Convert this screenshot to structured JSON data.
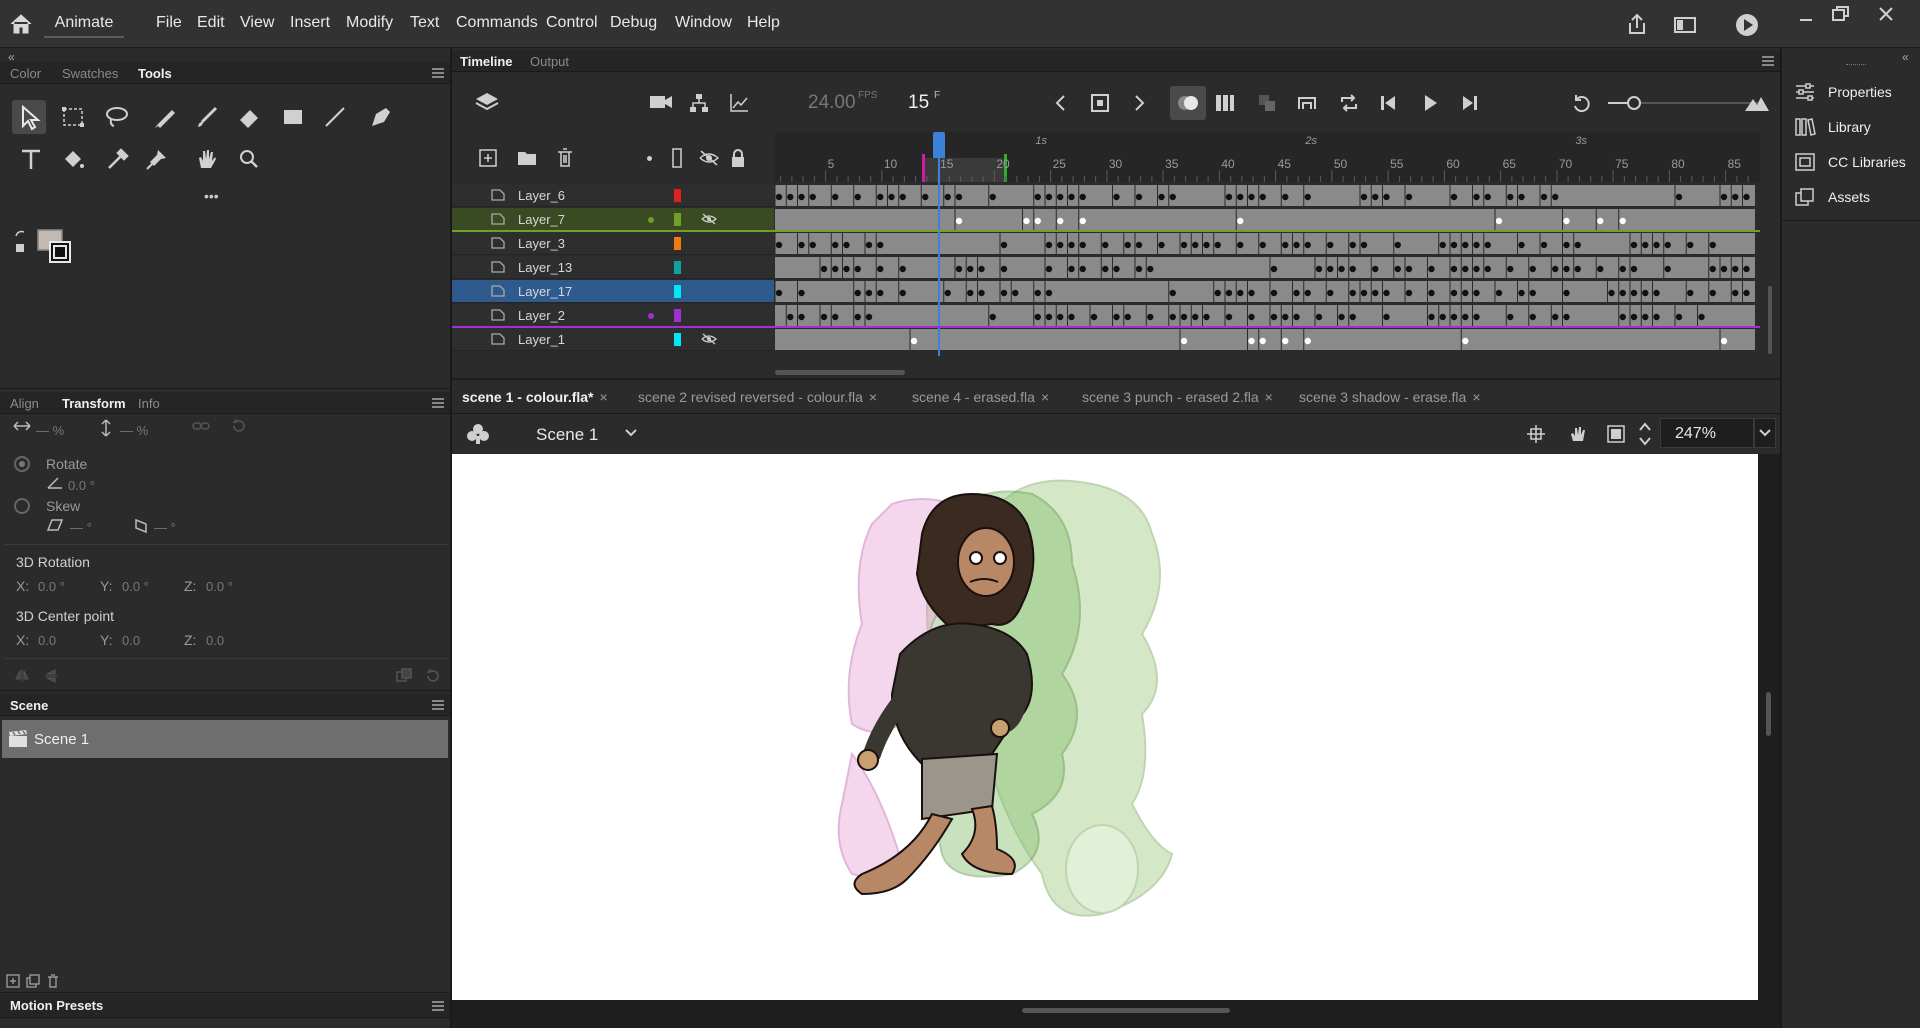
{
  "app": {
    "name": "Animate"
  },
  "menu": [
    "File",
    "Edit",
    "View",
    "Insert",
    "Modify",
    "Text",
    "Commands",
    "Control",
    "Debug",
    "Window",
    "Help"
  ],
  "left_panel": {
    "tabs": [
      "Color",
      "Swatches",
      "Tools"
    ],
    "active_tab": "Tools",
    "more": "•••",
    "collapse": "«",
    "transform_tabs": [
      "Align",
      "Transform",
      "Info"
    ],
    "transform": {
      "width_value": "— %",
      "height_value": "— %",
      "rotate_label": "Rotate",
      "rotate_value": "0.0 °",
      "skew_label": "Skew",
      "skew_h": "— °",
      "skew_v": "— °",
      "rotation3d_label": "3D Rotation",
      "center3d_label": "3D Center point",
      "x_label": "X:",
      "y_label": "Y:",
      "z_label": "Z:",
      "rot_x": "0.0 °",
      "rot_y": "0.0 °",
      "rot_z": "0.0 °",
      "ctr_x": "0.0",
      "ctr_y": "0.0",
      "ctr_z": "0.0"
    },
    "scene_panel": {
      "title": "Scene",
      "items": [
        "Scene 1"
      ]
    },
    "motion_presets": "Motion Presets"
  },
  "timeline": {
    "tabs": [
      "Timeline",
      "Output"
    ],
    "fps": "24.00",
    "fps_unit": "FPS",
    "frame": "15",
    "frame_unit": "F",
    "seconds": [
      "1s",
      "2s",
      "3s"
    ],
    "frame_ticks": [
      "5",
      "10",
      "15",
      "20",
      "25",
      "30",
      "35",
      "40",
      "45",
      "50",
      "55",
      "60",
      "65",
      "70",
      "75",
      "80",
      "85"
    ],
    "layers": [
      {
        "name": "Layer_6",
        "color": "#e02020",
        "selected": false,
        "hidden": false,
        "dot": false
      },
      {
        "name": "Layer_7",
        "color": "#6ea02a",
        "selected": false,
        "hidden": true,
        "dot": true,
        "dot_color": "#6ea02a"
      },
      {
        "name": "Layer_3",
        "color": "#f07a10",
        "selected": false,
        "hidden": false,
        "dot": false
      },
      {
        "name": "Layer_13",
        "color": "#10a0a0",
        "selected": false,
        "hidden": false,
        "dot": false
      },
      {
        "name": "Layer_17",
        "color": "#00e8f8",
        "selected": true,
        "hidden": false,
        "dot": false
      },
      {
        "name": "Layer_2",
        "color": "#a030d0",
        "selected": false,
        "hidden": false,
        "dot": true,
        "dot_color": "#a030d0"
      },
      {
        "name": "Layer_1",
        "color": "#00e8f8",
        "selected": false,
        "hidden": true,
        "dot": false
      }
    ]
  },
  "documents": {
    "tabs": [
      {
        "label": "scene 1 - colour.fla*",
        "active": true
      },
      {
        "label": "scene 2 revised reversed - colour.fla",
        "active": false
      },
      {
        "label": "scene 4 - erased.fla",
        "active": false
      },
      {
        "label": "scene 3 punch - erased 2.fla",
        "active": false
      },
      {
        "label": "scene 3 shadow - erase.fla",
        "active": false
      }
    ],
    "close_glyph": "×"
  },
  "stage": {
    "scene_name": "Scene 1",
    "zoom": "247%"
  },
  "right_panel": {
    "items": [
      "Properties",
      "Library",
      "CC Libraries",
      "Assets"
    ]
  }
}
